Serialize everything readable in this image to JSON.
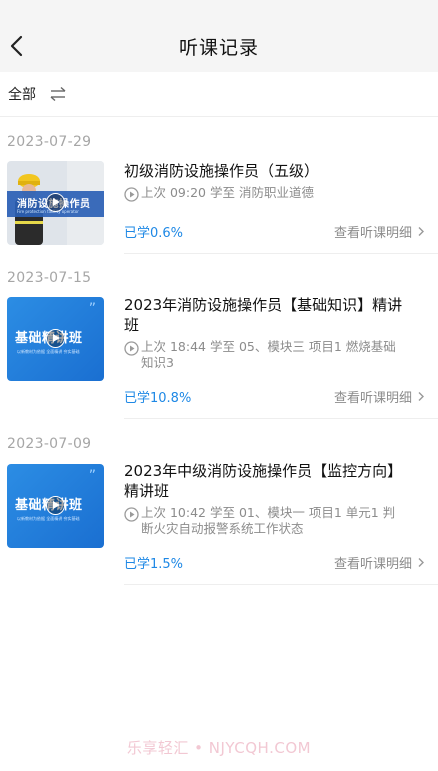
{
  "header": {
    "title": "听课记录"
  },
  "filter": {
    "label": "全部"
  },
  "records": [
    {
      "date": "2023-07-29",
      "thumb_text": "消防设施操作员",
      "thumb_sub": "Fire protection facility operator",
      "title_lines": [
        "初级消防设施操作员（五级）"
      ],
      "meta_lines": [
        "上次 09:20 学至 消防职业道德"
      ],
      "progress": "已学0.6%",
      "detail": "查看听课明细"
    },
    {
      "date": "2023-07-15",
      "thumb_text": "基础精讲班",
      "thumb_sub": "以新教材为依据  全面精讲  夯实基础",
      "title_lines": [
        "2023年消防设施操作员【基础知识】精讲",
        "班"
      ],
      "meta_lines": [
        "上次 18:44 学至 05、模块三 项目1 燃烧基础",
        "知识3"
      ],
      "progress": "已学10.8%",
      "detail": "查看听课明细"
    },
    {
      "date": "2023-07-09",
      "thumb_text": "基础精讲班",
      "thumb_sub": "以新教材为依据  全面精讲  夯实基础",
      "title_lines": [
        "2023年中级消防设施操作员【监控方向】",
        "精讲班"
      ],
      "meta_lines": [
        "上次 10:42 学至 01、模块一 项目1 单元1 判",
        "断火灾自动报警系统工作状态"
      ],
      "progress": "已学1.5%",
      "detail": "查看听课明细"
    }
  ],
  "watermark": "乐享轻汇 • NJYCQH.COM",
  "colors": {
    "accent": "#1e88e5",
    "muted": "#8c8c8c",
    "date": "#a6a6a6",
    "header_bg": "#f5f5f5"
  },
  "icons": {
    "back": "chevron-left-icon",
    "swap": "swap-arrows-icon",
    "clock": "clock-icon",
    "play": "play-icon",
    "detail": "chevron-right-icon"
  }
}
